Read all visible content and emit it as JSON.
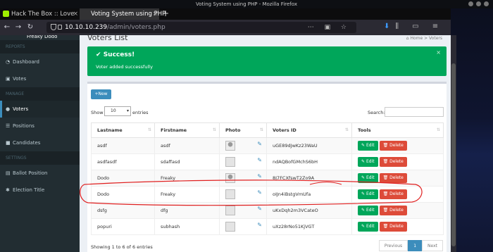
{
  "window": {
    "title": "Voting System using PHP - Mozilla Firefox"
  },
  "tabs": [
    {
      "label": "Hack The Box :: Love",
      "close": "×"
    },
    {
      "label": "Voting System using PHP",
      "close": "×"
    }
  ],
  "new_tab": "+",
  "nav": {
    "url_host": "10.10.10.239",
    "url_path": "/admin/voters.php"
  },
  "sidebar": {
    "user": "Freaky Dodo",
    "sections": [
      {
        "header": "REPORTS",
        "items": [
          {
            "label": "Dashboard",
            "icon": "dashboard-icon"
          },
          {
            "label": "Votes",
            "icon": "lock-icon"
          }
        ]
      },
      {
        "header": "MANAGE",
        "items": [
          {
            "label": "Voters",
            "icon": "users-icon",
            "active": true
          },
          {
            "label": "Positions",
            "icon": "tasks-icon"
          },
          {
            "label": "Candidates",
            "icon": "black-tie-icon"
          }
        ]
      },
      {
        "header": "SETTINGS",
        "items": [
          {
            "label": "Ballot Position",
            "icon": "file-text-icon"
          },
          {
            "label": "Election Title",
            "icon": "cog-icon"
          }
        ]
      }
    ]
  },
  "page": {
    "title": "Voters List",
    "breadcrumb_home": "Home",
    "breadcrumb_current": "Voters"
  },
  "alert": {
    "title": "Success!",
    "message": "Voter added successfully",
    "close": "×"
  },
  "toolbar": {
    "new_label": "New"
  },
  "table_controls": {
    "show_label": "Show",
    "page_size": "10",
    "entries_label": "entries",
    "search_label": "Search:"
  },
  "table": {
    "headers": [
      "Lastname",
      "Firstname",
      "Photo",
      "Voters ID",
      "Tools"
    ],
    "rows": [
      {
        "lastname": "asdf",
        "firstname": "asdf",
        "photo": "profile",
        "voters_id": "uGE89dJwKz23WaU"
      },
      {
        "lastname": "asdfasdf",
        "firstname": "sdaffasd",
        "photo": "broken",
        "voters_id": "ndAQBofGMchS6bH"
      },
      {
        "lastname": "Dodo",
        "firstname": "Freaky",
        "photo": "profile",
        "voters_id": "8J7FCXfswT2Zo9A"
      },
      {
        "lastname": "Dodo",
        "firstname": "Freaky",
        "photo": "broken",
        "voters_id": "oIJn4iBstgVmUfa"
      },
      {
        "lastname": "dsfg",
        "firstname": "dfg",
        "photo": "broken",
        "voters_id": "uKxDqh2m3VCateO"
      },
      {
        "lastname": "popuri",
        "firstname": "subhash",
        "photo": "broken",
        "voters_id": "uXz28rNo51KjVGT"
      }
    ],
    "edit_label": "Edit",
    "delete_label": "Delete"
  },
  "footer": {
    "info": "Showing 1 to 6 of 6 entries"
  },
  "pagination": {
    "previous": "Previous",
    "current": "1",
    "next": "Next"
  },
  "colors": {
    "success": "#00a65a",
    "danger": "#dd4b39",
    "primary": "#3c8dbc",
    "sidebar": "#222d32",
    "annotation": "#e02020"
  }
}
